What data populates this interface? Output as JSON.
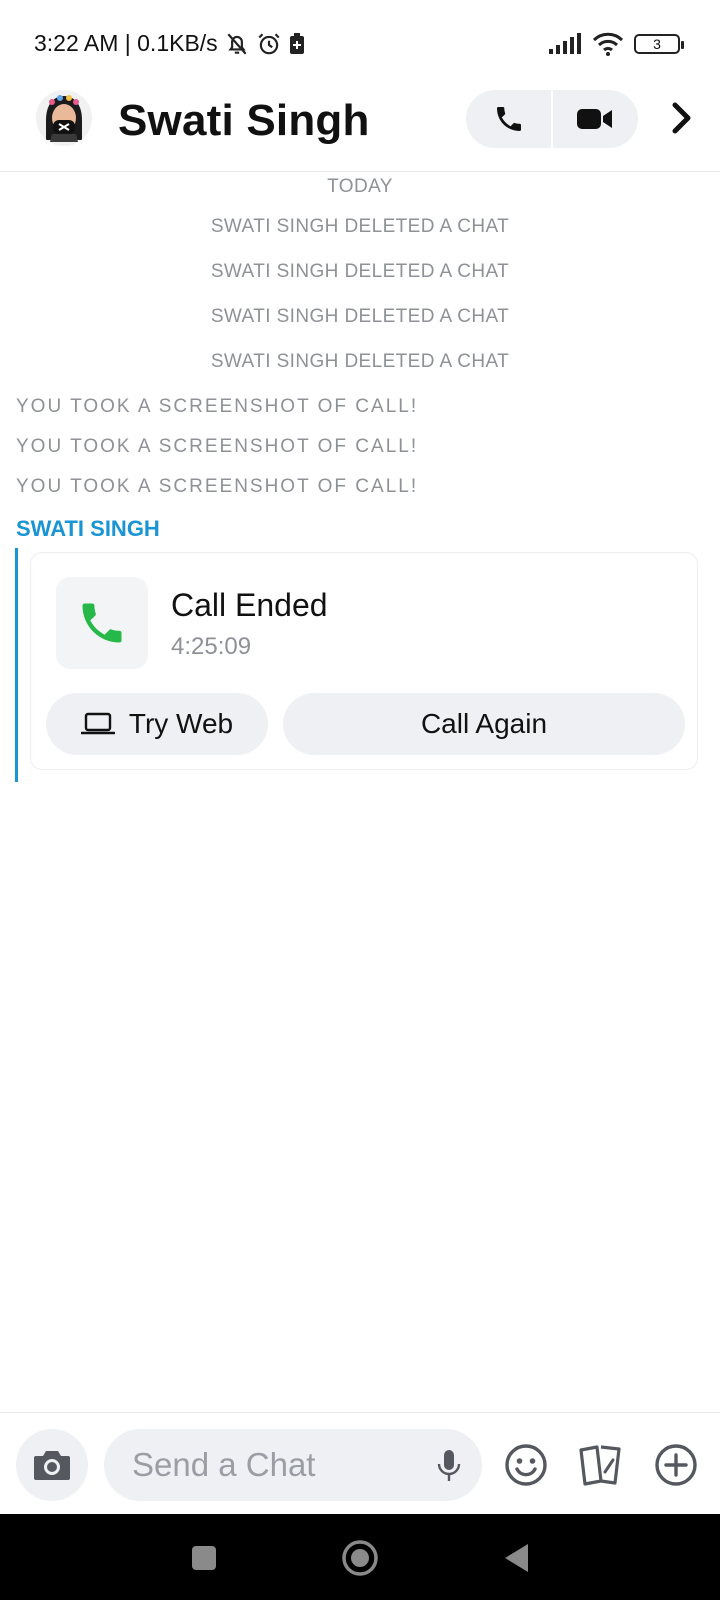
{
  "status_bar": {
    "time_speed": "3:22 AM | 0.1KB/s",
    "battery_level": "3"
  },
  "header": {
    "contact_name": "Swati Singh"
  },
  "chat": {
    "date_label": "TODAY",
    "deleted_notices": [
      "SWATI SINGH DELETED A CHAT",
      "SWATI SINGH DELETED A CHAT",
      "SWATI SINGH DELETED A CHAT",
      "SWATI SINGH DELETED A CHAT"
    ],
    "screenshot_notices": [
      "YOU TOOK A SCREENSHOT OF CALL!",
      "YOU TOOK A SCREENSHOT OF CALL!",
      "YOU TOOK A SCREENSHOT OF CALL!"
    ],
    "sender_label": "SWATI SINGH",
    "call_card": {
      "title": "Call Ended",
      "duration": "4:25:09",
      "try_web_label": "Try Web",
      "call_again_label": "Call Again"
    }
  },
  "input_bar": {
    "placeholder": "Send a Chat"
  },
  "colors": {
    "accent_blue": "#1a95d4",
    "call_green": "#27b84a",
    "pill_bg": "#eef0f3",
    "muted_text": "#8e9196"
  }
}
